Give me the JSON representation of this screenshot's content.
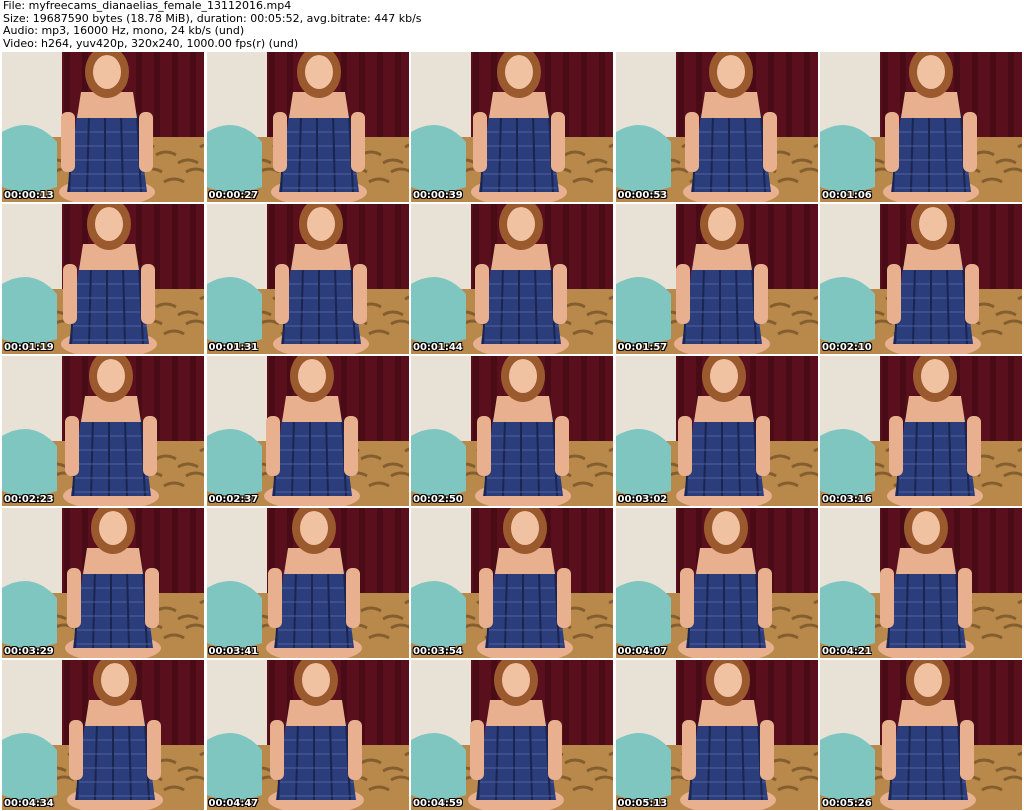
{
  "header": {
    "file_line": "File: myfreecams_dianaelias_female_13112016.mp4",
    "size_line": "Size: 19687590 bytes (18.78 MiB), duration: 00:05:52, avg.bitrate: 447 kb/s",
    "audio_line": "Audio: mp3, 16000 Hz, mono, 24 kb/s (und)",
    "video_line": "Video: h264, yuv420p, 320x240, 1000.00 fps(r) (und)"
  },
  "thumbnails": [
    {
      "timestamp": "00:00:13"
    },
    {
      "timestamp": "00:00:27"
    },
    {
      "timestamp": "00:00:39"
    },
    {
      "timestamp": "00:00:53"
    },
    {
      "timestamp": "00:01:06"
    },
    {
      "timestamp": "00:01:19"
    },
    {
      "timestamp": "00:01:31"
    },
    {
      "timestamp": "00:01:44"
    },
    {
      "timestamp": "00:01:57"
    },
    {
      "timestamp": "00:02:10"
    },
    {
      "timestamp": "00:02:23"
    },
    {
      "timestamp": "00:02:37"
    },
    {
      "timestamp": "00:02:50"
    },
    {
      "timestamp": "00:03:02"
    },
    {
      "timestamp": "00:03:16"
    },
    {
      "timestamp": "00:03:29"
    },
    {
      "timestamp": "00:03:41"
    },
    {
      "timestamp": "00:03:54"
    },
    {
      "timestamp": "00:04:07"
    },
    {
      "timestamp": "00:04:21"
    },
    {
      "timestamp": "00:04:34"
    },
    {
      "timestamp": "00:04:47"
    },
    {
      "timestamp": "00:04:59"
    },
    {
      "timestamp": "00:05:13"
    },
    {
      "timestamp": "00:05:26"
    }
  ],
  "colors": {
    "wall": "#e8e2d6",
    "curtain": "#5a0f1c",
    "bed": "#b8894a",
    "pillow": "#7fc6c0",
    "dress": "#2b3d7a",
    "skin": "#e8b08e",
    "hair": "#9a5a2e"
  }
}
